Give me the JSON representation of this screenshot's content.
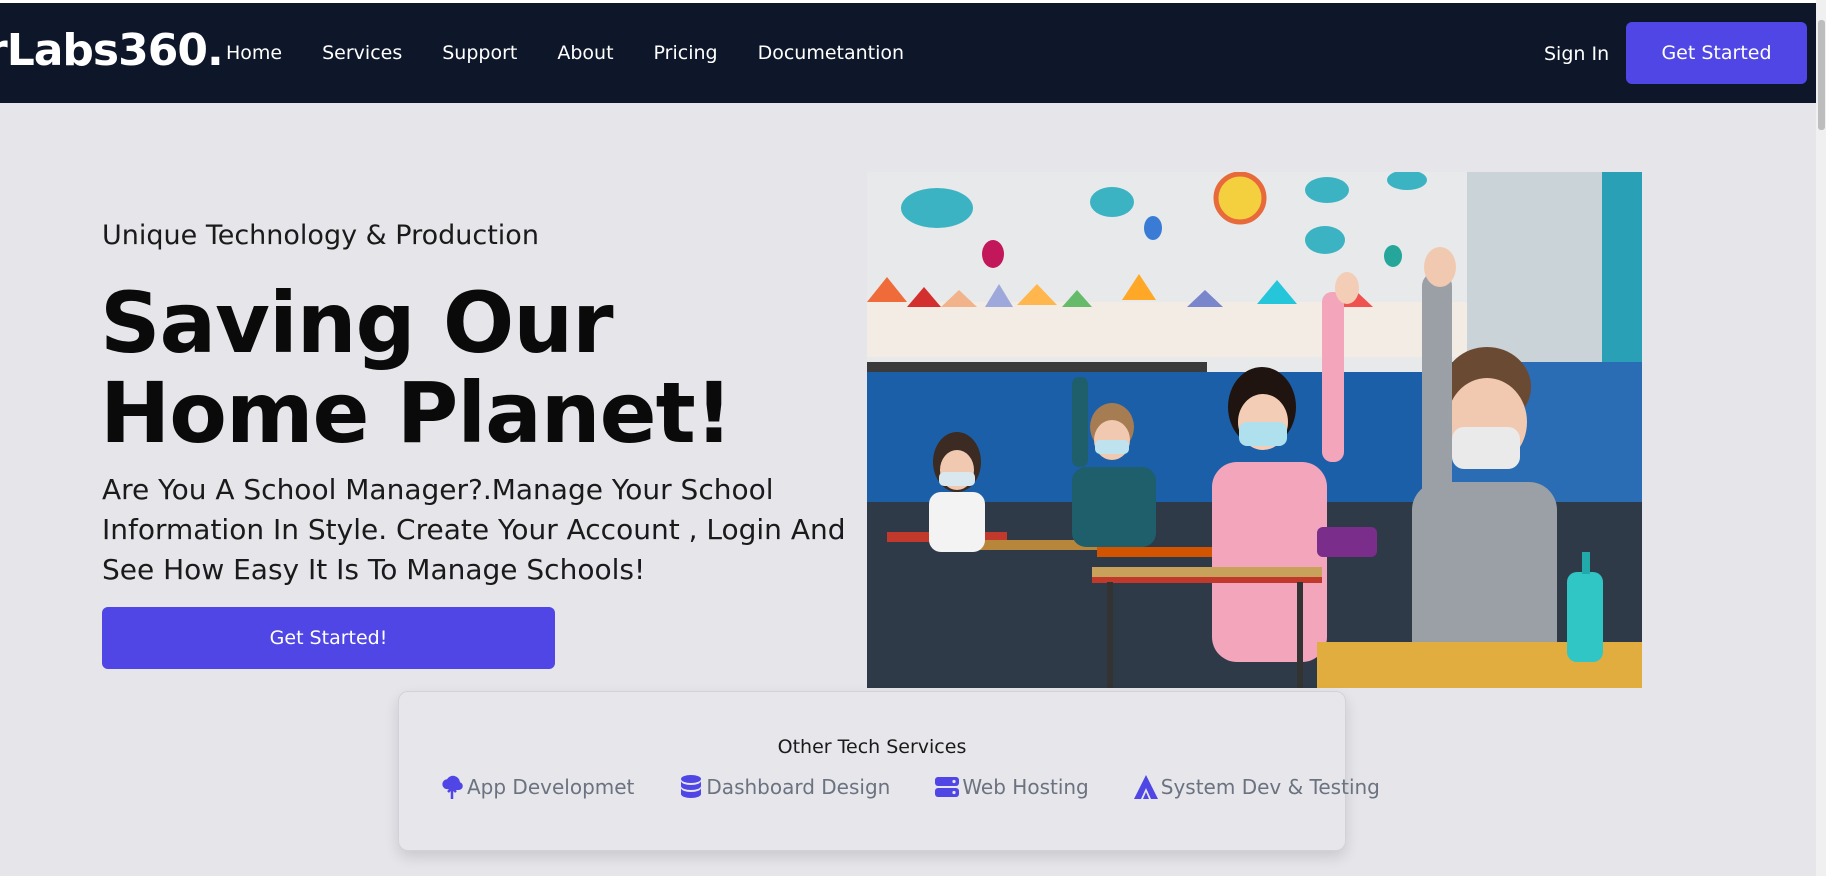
{
  "nav": {
    "logo": "rLabs360.",
    "links": [
      "Home",
      "Services",
      "Support",
      "About",
      "Pricing",
      "Documetantion"
    ],
    "signin": "Sign In",
    "cta": "Get Started"
  },
  "hero": {
    "eyebrow": "Unique Technology & Production",
    "headline": "Saving Our Home Planet!",
    "lead": "Are You A School Manager?.Manage Your School Information In Style. Create Your Account , Login And See How Easy It Is To Manage Schools!",
    "cta": "Get Started!"
  },
  "services": {
    "title": "Other Tech Services",
    "items": [
      {
        "label": "App Developmet",
        "icon": "cloud-upload-icon"
      },
      {
        "label": "Dashboard Design",
        "icon": "database-icon"
      },
      {
        "label": "Web Hosting",
        "icon": "server-icon"
      },
      {
        "label": "System Dev & Testing",
        "icon": "triangle-a-icon"
      }
    ]
  },
  "colors": {
    "nav_bg": "#0e1629",
    "accent": "#4f46e5",
    "page_bg": "#e5e5ea"
  }
}
